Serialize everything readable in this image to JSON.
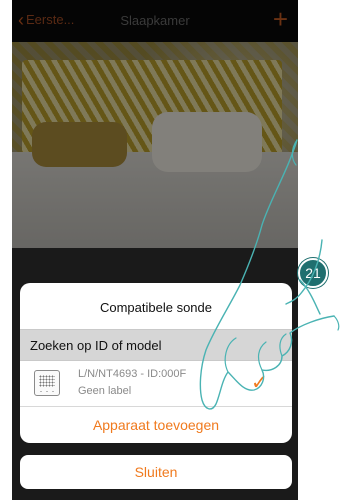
{
  "navbar": {
    "back_label": "Eerste...",
    "title": "Slaapkamer",
    "plus_label": "+"
  },
  "dialog": {
    "title": "Compatibele sonde",
    "search_label": "Zoeken op ID of model",
    "device": {
      "id": "L/N/NT4693 - ID:000F",
      "label": "Geen label",
      "icon": "device-thermostat-icon",
      "check_icon": "checkmark-icon"
    },
    "add_button": "Apparaat toevoegen"
  },
  "close_button": "Sluiten",
  "step_badge": "21",
  "colors": {
    "accent": "#f07a1e",
    "badge": "#1f6f6f"
  }
}
